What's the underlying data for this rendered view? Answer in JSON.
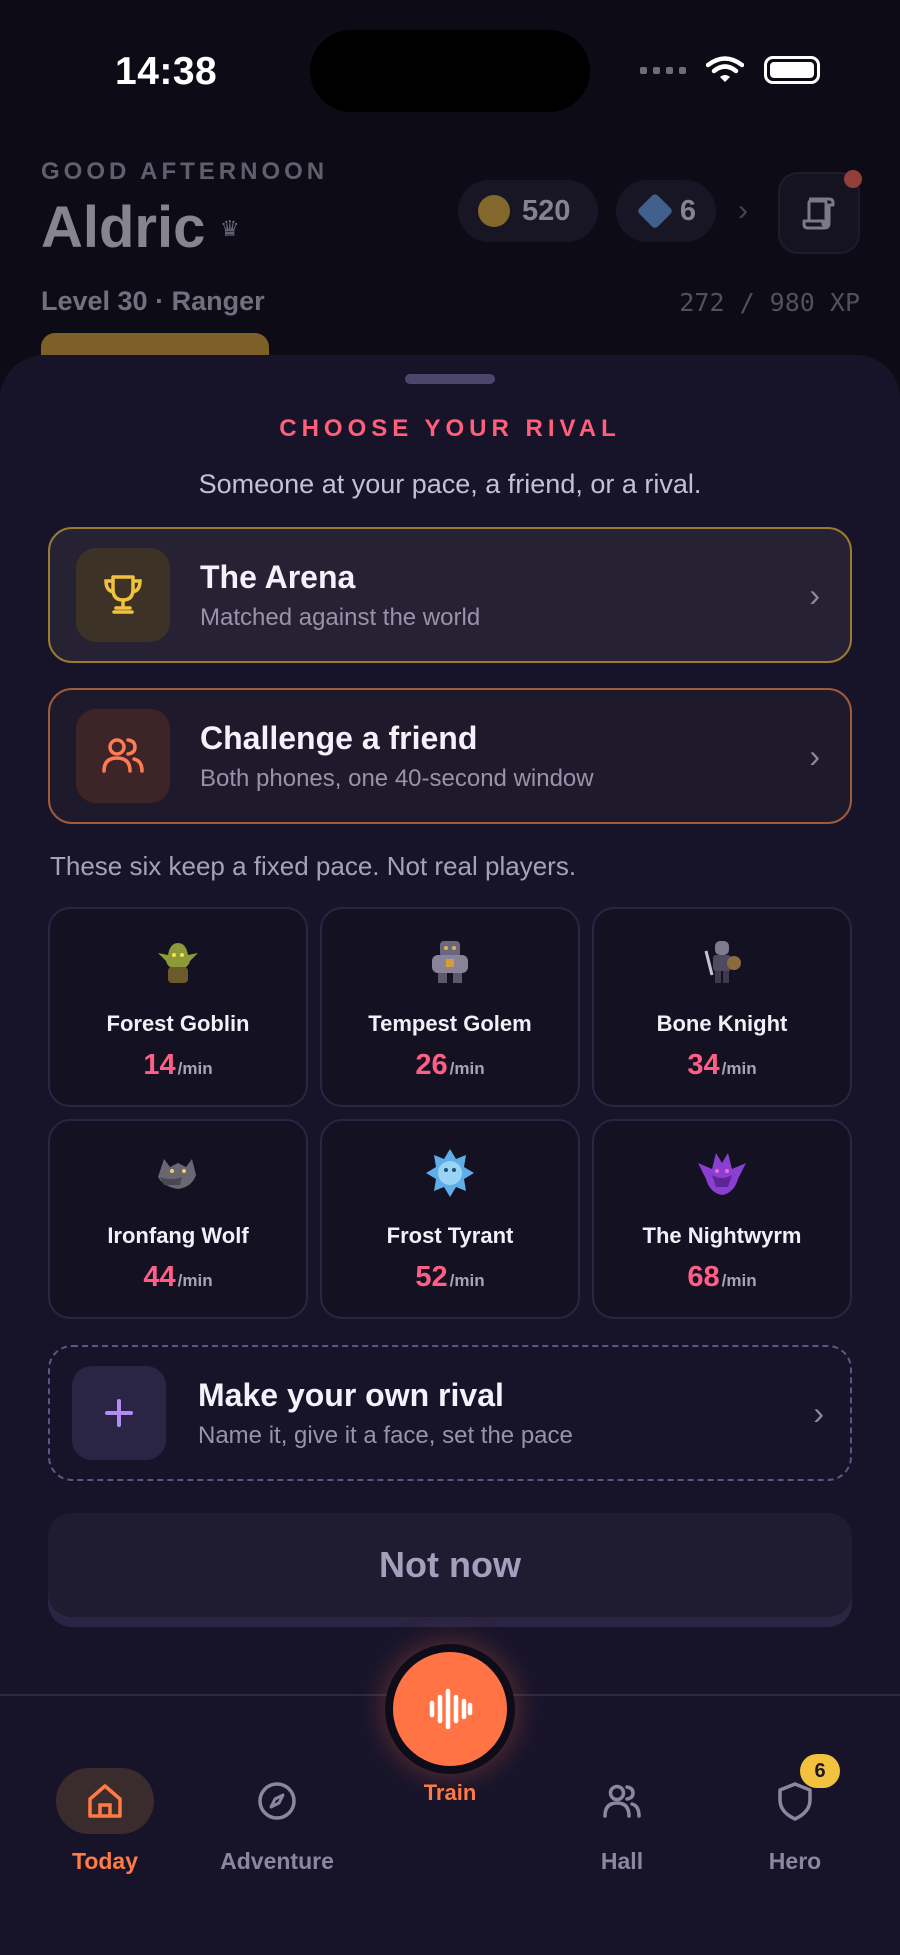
{
  "status_bar": {
    "time": "14:38"
  },
  "header": {
    "greeting": "GOOD AFTERNOON",
    "name": "Aldric",
    "level_line": "Level 30 · Ranger",
    "xp": "272 / 980 XP",
    "xp_progress": 0.28,
    "coins": "520",
    "gems": "6",
    "colors": {
      "coin": "#e3b43d",
      "gem": "#6ea6ee",
      "xp_bar": "#d8a635",
      "notification_dot": "#ff6a55"
    }
  },
  "sheet": {
    "eyebrow": "CHOOSE YOUR RIVAL",
    "subtitle": "Someone at your pace, a friend, or a rival.",
    "options": [
      {
        "title": "The Arena",
        "subtitle": "Matched against the world",
        "icon": "trophy-icon"
      },
      {
        "title": "Challenge a friend",
        "subtitle": "Both phones, one 40-second window",
        "icon": "friends-icon"
      }
    ],
    "note": "These six keep a fixed pace. Not real players.",
    "rivals": [
      {
        "name": "Forest Goblin",
        "pace": "14",
        "unit": "/min"
      },
      {
        "name": "Tempest Golem",
        "pace": "26",
        "unit": "/min"
      },
      {
        "name": "Bone Knight",
        "pace": "34",
        "unit": "/min"
      },
      {
        "name": "Ironfang Wolf",
        "pace": "44",
        "unit": "/min"
      },
      {
        "name": "Frost Tyrant",
        "pace": "52",
        "unit": "/min"
      },
      {
        "name": "The Nightwyrm",
        "pace": "68",
        "unit": "/min"
      }
    ],
    "custom": {
      "title": "Make your own rival",
      "subtitle": "Name it, give it a face, set the pace",
      "icon": "plus-icon"
    },
    "dismiss": "Not now",
    "colors": {
      "accent": "#ff5f78",
      "pace": "#ff5f86",
      "arena_border": "#9a7a2f",
      "friend_border": "#a05a3c"
    }
  },
  "tabbar": {
    "today": "Today",
    "adventure": "Adventure",
    "train": "Train",
    "hall": "Hall",
    "hero": "Hero",
    "hero_badge": "6",
    "colors": {
      "active": "#ff7a45",
      "train_button": "#ff7345",
      "badge": "#f2c23e"
    }
  }
}
